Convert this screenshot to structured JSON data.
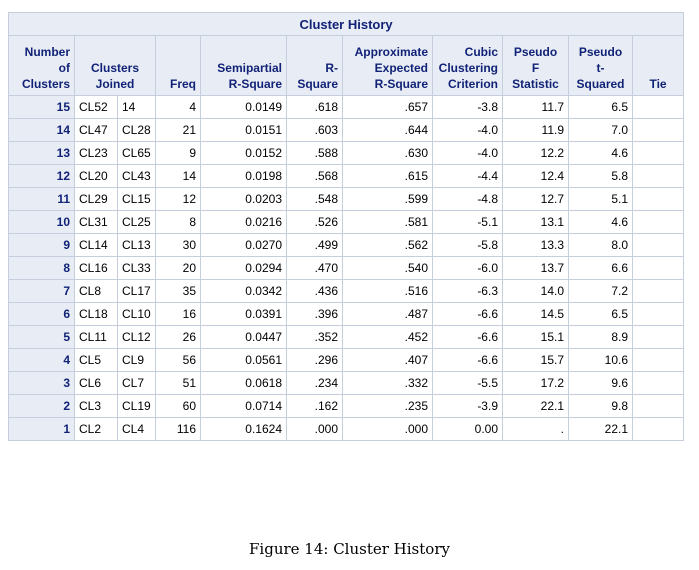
{
  "title": "Cluster History",
  "headers": {
    "number_of_clusters": [
      "Number",
      "of",
      "Clusters"
    ],
    "clusters_joined": [
      "Clusters",
      "Joined"
    ],
    "freq": [
      "Freq"
    ],
    "semipartial": [
      "Semipartial",
      "R-Square"
    ],
    "rsquare": [
      "R-",
      "Square"
    ],
    "approx_expected": [
      "Approximate",
      "Expected",
      "R-Square"
    ],
    "ccc": [
      "Cubic",
      "Clustering",
      "Criterion"
    ],
    "pseudo_f": [
      "Pseudo",
      "F",
      "Statistic"
    ],
    "pseudo_t": [
      "Pseudo",
      "t-",
      "Squared"
    ],
    "tie": [
      "Tie"
    ]
  },
  "rows": [
    {
      "n": "15",
      "j1": "CL52",
      "j2": "14",
      "freq": "4",
      "spr": "0.0149",
      "rsq": ".618",
      "erq": ".657",
      "ccc": "-3.8",
      "f": "11.7",
      "t": "6.5",
      "tie": ""
    },
    {
      "n": "14",
      "j1": "CL47",
      "j2": "CL28",
      "freq": "21",
      "spr": "0.0151",
      "rsq": ".603",
      "erq": ".644",
      "ccc": "-4.0",
      "f": "11.9",
      "t": "7.0",
      "tie": ""
    },
    {
      "n": "13",
      "j1": "CL23",
      "j2": "CL65",
      "freq": "9",
      "spr": "0.0152",
      "rsq": ".588",
      "erq": ".630",
      "ccc": "-4.0",
      "f": "12.2",
      "t": "4.6",
      "tie": ""
    },
    {
      "n": "12",
      "j1": "CL20",
      "j2": "CL43",
      "freq": "14",
      "spr": "0.0198",
      "rsq": ".568",
      "erq": ".615",
      "ccc": "-4.4",
      "f": "12.4",
      "t": "5.8",
      "tie": ""
    },
    {
      "n": "11",
      "j1": "CL29",
      "j2": "CL15",
      "freq": "12",
      "spr": "0.0203",
      "rsq": ".548",
      "erq": ".599",
      "ccc": "-4.8",
      "f": "12.7",
      "t": "5.1",
      "tie": ""
    },
    {
      "n": "10",
      "j1": "CL31",
      "j2": "CL25",
      "freq": "8",
      "spr": "0.0216",
      "rsq": ".526",
      "erq": ".581",
      "ccc": "-5.1",
      "f": "13.1",
      "t": "4.6",
      "tie": ""
    },
    {
      "n": "9",
      "j1": "CL14",
      "j2": "CL13",
      "freq": "30",
      "spr": "0.0270",
      "rsq": ".499",
      "erq": ".562",
      "ccc": "-5.8",
      "f": "13.3",
      "t": "8.0",
      "tie": ""
    },
    {
      "n": "8",
      "j1": "CL16",
      "j2": "CL33",
      "freq": "20",
      "spr": "0.0294",
      "rsq": ".470",
      "erq": ".540",
      "ccc": "-6.0",
      "f": "13.7",
      "t": "6.6",
      "tie": ""
    },
    {
      "n": "7",
      "j1": "CL8",
      "j2": "CL17",
      "freq": "35",
      "spr": "0.0342",
      "rsq": ".436",
      "erq": ".516",
      "ccc": "-6.3",
      "f": "14.0",
      "t": "7.2",
      "tie": ""
    },
    {
      "n": "6",
      "j1": "CL18",
      "j2": "CL10",
      "freq": "16",
      "spr": "0.0391",
      "rsq": ".396",
      "erq": ".487",
      "ccc": "-6.6",
      "f": "14.5",
      "t": "6.5",
      "tie": ""
    },
    {
      "n": "5",
      "j1": "CL11",
      "j2": "CL12",
      "freq": "26",
      "spr": "0.0447",
      "rsq": ".352",
      "erq": ".452",
      "ccc": "-6.6",
      "f": "15.1",
      "t": "8.9",
      "tie": ""
    },
    {
      "n": "4",
      "j1": "CL5",
      "j2": "CL9",
      "freq": "56",
      "spr": "0.0561",
      "rsq": ".296",
      "erq": ".407",
      "ccc": "-6.6",
      "f": "15.7",
      "t": "10.6",
      "tie": ""
    },
    {
      "n": "3",
      "j1": "CL6",
      "j2": "CL7",
      "freq": "51",
      "spr": "0.0618",
      "rsq": ".234",
      "erq": ".332",
      "ccc": "-5.5",
      "f": "17.2",
      "t": "9.6",
      "tie": ""
    },
    {
      "n": "2",
      "j1": "CL3",
      "j2": "CL19",
      "freq": "60",
      "spr": "0.0714",
      "rsq": ".162",
      "erq": ".235",
      "ccc": "-3.9",
      "f": "22.1",
      "t": "9.8",
      "tie": ""
    },
    {
      "n": "1",
      "j1": "CL2",
      "j2": "CL4",
      "freq": "116",
      "spr": "0.1624",
      "rsq": ".000",
      "erq": ".000",
      "ccc": "0.00",
      "f": ".",
      "t": "22.1",
      "tie": ""
    }
  ],
  "figure_caption": "Figure 14: Cluster History"
}
